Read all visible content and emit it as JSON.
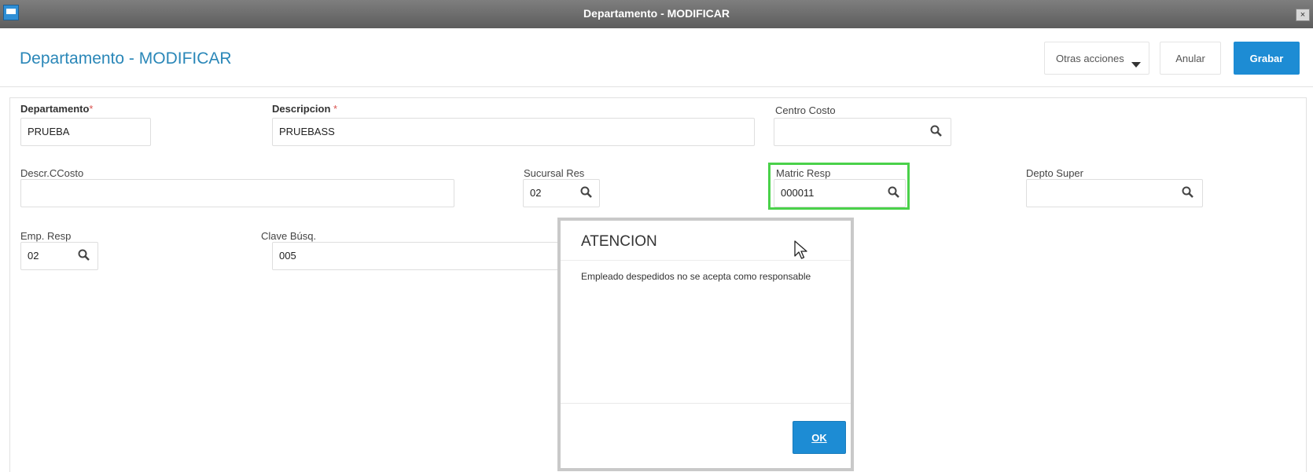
{
  "window": {
    "title": "Departamento - MODIFICAR",
    "close_label": "×"
  },
  "header": {
    "page_title": "Departamento - MODIFICAR",
    "actions": {
      "otras": "Otras acciones",
      "anular": "Anular",
      "grabar": "Grabar"
    }
  },
  "form": {
    "departamento": {
      "label": "Departamento",
      "required_mark": "*",
      "value": "PRUEBA"
    },
    "descripcion": {
      "label": "Descripcion ",
      "required_mark": "*",
      "value": "PRUEBASS"
    },
    "centro_costo": {
      "label": "Centro Costo",
      "value": ""
    },
    "descr_ccosto": {
      "label": "Descr.CCosto",
      "value": ""
    },
    "sucursal_res": {
      "label": "Sucursal Res",
      "value": "02"
    },
    "matric_resp": {
      "label": "Matric Resp",
      "value": "000011"
    },
    "depto_super": {
      "label": "Depto Super",
      "value": ""
    },
    "emp_resp": {
      "label": "Emp. Resp",
      "value": "02"
    },
    "clave_busq": {
      "label": "Clave Búsq.",
      "value": "005"
    }
  },
  "dialog": {
    "title": "ATENCION",
    "message": "Empleado despedidos no se acepta como responsable",
    "ok_label": "OK"
  },
  "colors": {
    "accent": "#1d8cd4",
    "title_blue": "#2a87b8",
    "focus_green": "#4ad14a",
    "required_red": "#d9534f"
  }
}
